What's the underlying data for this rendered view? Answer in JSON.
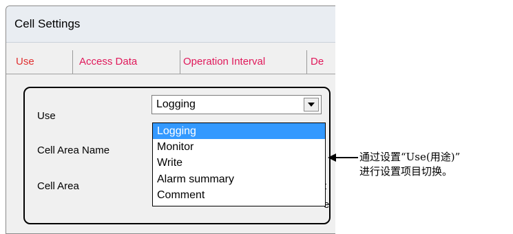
{
  "window": {
    "title": "Cell Settings",
    "tabs": [
      "Use",
      "Access Data",
      "Operation Interval",
      "De"
    ]
  },
  "form": {
    "use_label": "Use",
    "cell_area_name_label": "Cell Area Name",
    "cell_area_label": "Cell Area",
    "use_value": "Logging",
    "use_options": [
      "Logging",
      "Monitor",
      "Write",
      "Alarm summary",
      "Comment"
    ],
    "background_fragments": [
      "t",
      "e"
    ]
  },
  "annotation": {
    "line1": "通过设置“Use(用途)”",
    "line2": "进行设置项目切换。"
  },
  "colors": {
    "tab_text": "#e0185a",
    "selected_item_bg": "#3399ff"
  }
}
